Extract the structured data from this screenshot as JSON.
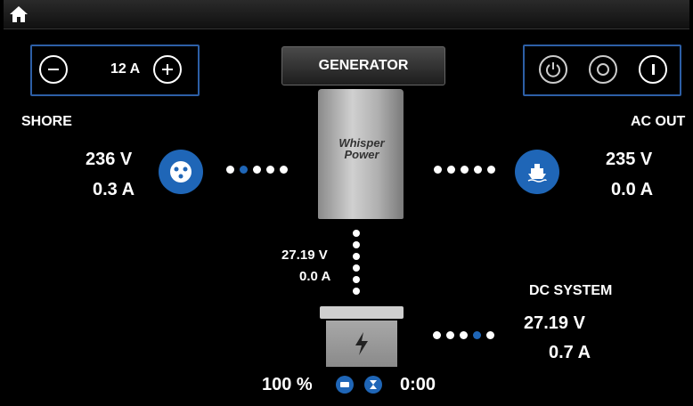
{
  "top": {
    "title": ""
  },
  "current_control": {
    "value": "12 A"
  },
  "generator_button": {
    "label": "GENERATOR"
  },
  "power_controls": {
    "items": [
      "power",
      "standby",
      "on"
    ]
  },
  "shore": {
    "label": "SHORE",
    "voltage": "236 V",
    "current": "0.3 A"
  },
  "ac_out": {
    "label": "AC OUT",
    "voltage": "235 V",
    "current": "0.0 A"
  },
  "gen_output": {
    "voltage": "27.19 V",
    "current": "0.0 A"
  },
  "dc_system": {
    "label": "DC SYSTEM",
    "voltage": "27.19 V",
    "current": "0.7 A"
  },
  "battery": {
    "percent": "100 %",
    "time": "0:00"
  },
  "brand": {
    "logo_text": "Whisper Power"
  },
  "colors": {
    "accent_blue": "#1f66b7",
    "panel_border": "#2d5fa6"
  },
  "icons": [
    "home-icon",
    "minus-icon",
    "plus-icon",
    "power-icon",
    "standby-icon",
    "on-icon",
    "shore-plug-icon",
    "boat-icon",
    "battery-icon",
    "battery-status-icon",
    "timer-icon"
  ]
}
